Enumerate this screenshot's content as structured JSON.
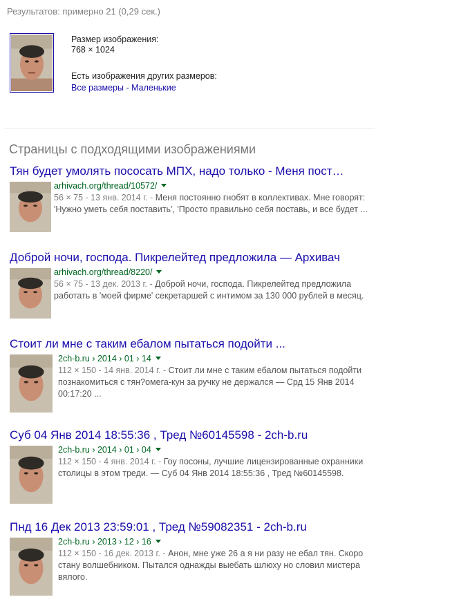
{
  "stats": "Результатов: примерно 21 (0,29 сек.)",
  "image_info": {
    "size_label": "Размер изображения:",
    "size_value": "768 × 1024",
    "other_sizes_label": "Есть изображения других размеров:",
    "link_all": "Все размеры",
    "separator": " - ",
    "link_small": "Маленькие"
  },
  "section_heading": "Страницы с подходящими изображениями",
  "results": [
    {
      "title": "Тян будет умолять пососать МПХ, надо только - Меня пост…",
      "url": "arhivach.org/thread/10572/",
      "meta": "56 × 75 - 13 янв. 2014 г. - ",
      "snippet": "Меня постоянно гнобят в коллективах. Мне говорят: 'Нужно уметь себя поставить', 'Просто правильно себя поставь, и все будет ..."
    },
    {
      "title": "Доброй ночи, господа. Пикрелейтед предложила — Архивач",
      "url": "arhivach.org/thread/8220/",
      "meta": "56 × 75 - 13 дек. 2013 г. - ",
      "snippet": "Доброй ночи, господа. Пикрелейтед предложила работать в 'моей фирме' секретаршей с интимом за 130 000 рублей в месяц."
    },
    {
      "title": "Стоит ли мне с таким ебалом пытаться подойти ...",
      "url": "2ch-b.ru › 2014 › 01 › 14",
      "meta": "112 × 150 - 14 янв. 2014 г. - ",
      "snippet": "Стоит ли мне с таким ебалом пытаться подойти познакомиться с тян?омега-кун за ручку не держался — Срд 15 Янв 2014 00:17:20 ..."
    },
    {
      "title": "Суб 04 Янв 2014 18:55:36 , Тред №60145598 - 2ch-b.ru",
      "url": "2ch-b.ru › 2014 › 01 › 04",
      "meta": "112 × 150 - 4 янв. 2014 г. - ",
      "snippet": "Гоу посоны, лучшие лицензированные охранники столицы в этом треди. — Суб 04 Янв 2014 18:55:36 , Тред №60145598."
    },
    {
      "title": "Пнд 16 Дек 2013 23:59:01 , Тред №59082351 - 2ch-b.ru",
      "url": "2ch-b.ru › 2013 › 12 › 16",
      "meta": "112 × 150 - 16 дек. 2013 г. - ",
      "snippet": "Анон, мне уже 26 а я ни разу не ебал тян. Скоро стану волшебником. Пытался однажды выебать шлюху но словил мистера вялого."
    }
  ]
}
